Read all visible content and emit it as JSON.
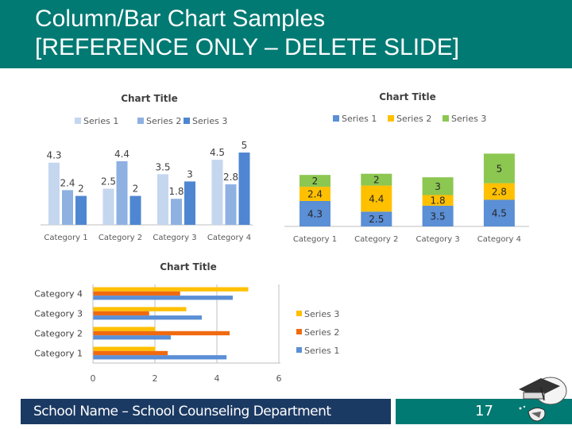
{
  "slide": {
    "title_line1": "Column/Bar Chart Samples",
    "title_line2": "[REFERENCE ONLY – DELETE SLIDE]",
    "footer_text": "School Name – School Counseling Department",
    "page_number": "17",
    "logo_icon": "school-graduation-cap-logo"
  },
  "colors": {
    "header": "#007a73",
    "footer_left": "#1b3a63",
    "footer_right": "#007a73"
  },
  "chart_data": [
    {
      "type": "bar",
      "subtype": "clustered-column",
      "title": "Chart Title",
      "categories": [
        "Category 1",
        "Category 2",
        "Category 3",
        "Category 4"
      ],
      "series": [
        {
          "name": "Series 1",
          "values": [
            4.3,
            2.5,
            3.5,
            4.5
          ],
          "color": "#c5d6ef"
        },
        {
          "name": "Series 2",
          "values": [
            2.4,
            4.4,
            1.8,
            2.8
          ],
          "color": "#8eb1e2"
        },
        {
          "name": "Series 3",
          "values": [
            2,
            2,
            3,
            5
          ],
          "color": "#4f86d1"
        }
      ],
      "data_labels": true,
      "legend": "top",
      "ylim": [
        0,
        5
      ],
      "grid": false,
      "xlabel": "",
      "ylabel": ""
    },
    {
      "type": "bar",
      "subtype": "stacked-column",
      "title": "Chart Title",
      "categories": [
        "Category 1",
        "Category 2",
        "Category 3",
        "Category 4"
      ],
      "series": [
        {
          "name": "Series 1",
          "values": [
            4.3,
            2.5,
            3.5,
            4.5
          ],
          "color": "#5b8fd6"
        },
        {
          "name": "Series 2",
          "values": [
            2.4,
            4.4,
            1.8,
            2.8
          ],
          "color": "#ffc000"
        },
        {
          "name": "Series 3",
          "values": [
            2,
            2,
            3,
            5
          ],
          "color": "#8cc751"
        }
      ],
      "data_labels": true,
      "legend": "top",
      "ylim": [
        0,
        12.3
      ],
      "grid": false,
      "xlabel": "",
      "ylabel": ""
    },
    {
      "type": "bar",
      "subtype": "clustered-horizontal-bar",
      "title": "Chart Title",
      "categories": [
        "Category 1",
        "Category 2",
        "Category 3",
        "Category 4"
      ],
      "series": [
        {
          "name": "Series 1",
          "values": [
            4.3,
            2.5,
            3.5,
            4.5
          ],
          "color": "#5b8fd6"
        },
        {
          "name": "Series 2",
          "values": [
            2.4,
            4.4,
            1.8,
            2.8
          ],
          "color": "#f06a10"
        },
        {
          "name": "Series 3",
          "values": [
            2,
            2,
            3,
            5
          ],
          "color": "#ffc000"
        }
      ],
      "xticks": [
        "0",
        "2",
        "4",
        "6"
      ],
      "xlim": [
        0,
        6
      ],
      "data_labels": false,
      "legend": "right",
      "grid": true,
      "xlabel": "",
      "ylabel": ""
    }
  ]
}
